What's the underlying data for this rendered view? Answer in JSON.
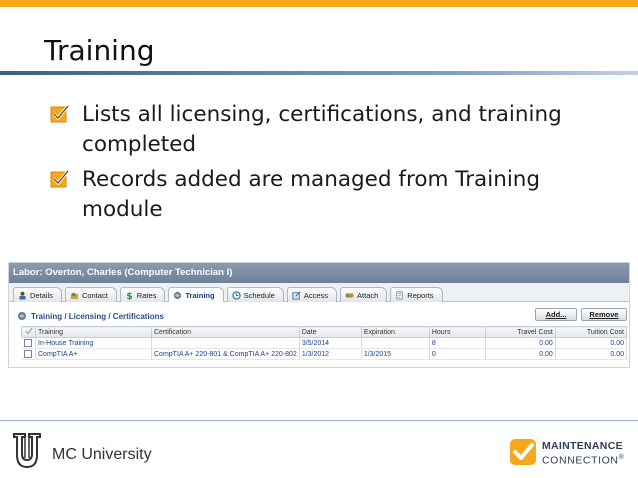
{
  "slide": {
    "title": "Training",
    "bullets": [
      "Lists all licensing, certifications, and training completed",
      "Records added are managed from Training module"
    ],
    "footer_text": "MC University",
    "brand_line1": "MAINTENANCE",
    "brand_line2": "CONNECTION",
    "brand_mark": "®",
    "accent_color": "#f5a81c"
  },
  "app": {
    "header": "Labor: Overton, Charles  (Computer Technician I)",
    "tabs": [
      {
        "label": "Details",
        "icon": "person-icon"
      },
      {
        "label": "Contact",
        "icon": "contact-icon"
      },
      {
        "label": "Rates",
        "icon": "dollar-icon"
      },
      {
        "label": "Training",
        "icon": "training-icon",
        "active": true
      },
      {
        "label": "Schedule",
        "icon": "schedule-icon"
      },
      {
        "label": "Access",
        "icon": "access-icon"
      },
      {
        "label": "Attach",
        "icon": "attach-icon"
      },
      {
        "label": "Reports",
        "icon": "reports-icon"
      }
    ],
    "section_title": "Training / Licensing / Certifications",
    "add_label": "Add...",
    "remove_label": "Remove",
    "columns": [
      "Training",
      "Certification",
      "Date",
      "Expiration",
      "Hours",
      "Travel Cost",
      "Tuition Cost"
    ],
    "rows": [
      {
        "training": "In-House Training",
        "certification": "",
        "date": "3/5/2014",
        "expiration": "",
        "hours": "8",
        "travel": "0.00",
        "tuition": "0.00"
      },
      {
        "training": "CompTIA A+",
        "certification": "CompTIA A+ 220-801 & CompTIA A+ 220-802",
        "date": "1/3/2012",
        "expiration": "1/3/2015",
        "hours": "0",
        "travel": "0.00",
        "tuition": "0.00"
      }
    ]
  }
}
